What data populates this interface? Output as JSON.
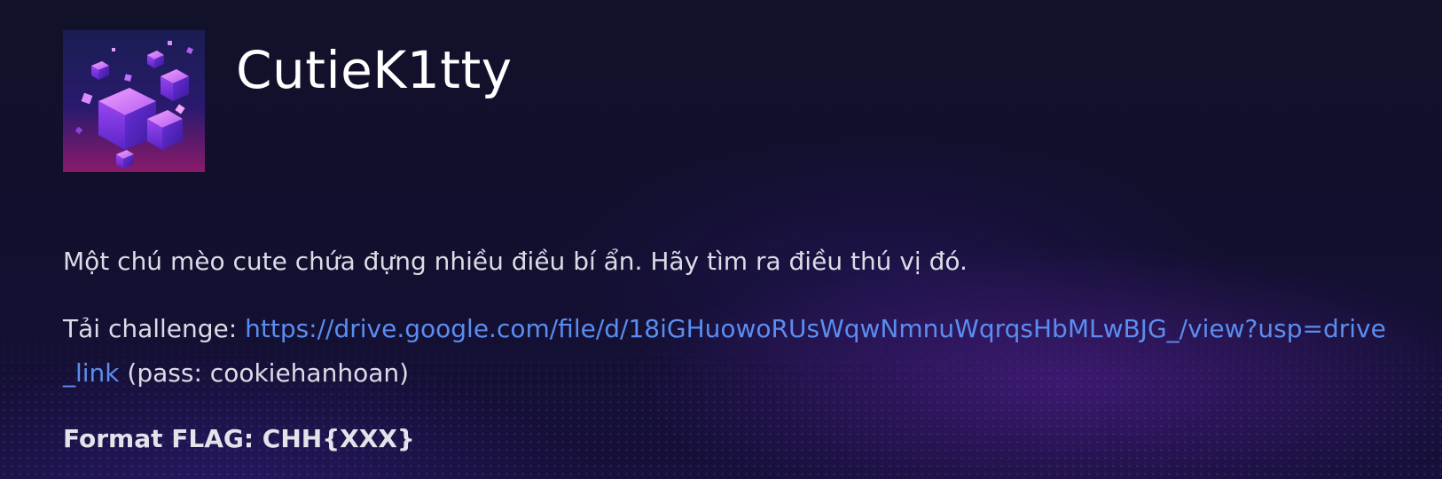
{
  "challenge": {
    "title": "CutieK1tty",
    "description": "Một chú mèo cute chứa đựng nhiều điều bí ẩn. Hãy tìm ra điều thú vị đó.",
    "download_label": "Tải challenge: ",
    "download_link_text": "https://drive.google.com/file/d/18iGHuowoRUsWqwNmnuWqrqsHbMLwBJG_/view?usp=drive_link",
    "download_link_href": "https://drive.google.com/file/d/18iGHuowoRUsWqwNmnuWqrqsHbMLwBJG_/view?usp=drive_link",
    "password_note": " (pass: cookiehanhoan)",
    "flag_format": "Format FLAG: CHH{XXX}"
  },
  "avatar": {
    "icon": "purple-cubes-image"
  }
}
